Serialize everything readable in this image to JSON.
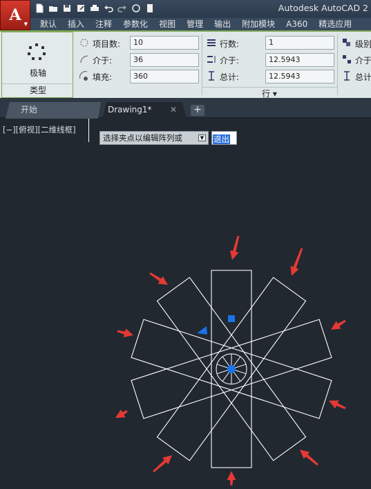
{
  "title_bar": {
    "app_menu_letter": "A",
    "title": "Autodesk AutoCAD 2"
  },
  "ribbon_tabs": [
    "默认",
    "插入",
    "注释",
    "参数化",
    "视图",
    "管理",
    "输出",
    "附加模块",
    "A360",
    "精选应用"
  ],
  "ribbon": {
    "type_panel": {
      "button_label": "极轴",
      "panel_title": "类型"
    },
    "items_panel": {
      "items_label": "项目数:",
      "items_value": "10",
      "between_label": "介于:",
      "between_value": "36",
      "fill_label": "填充:",
      "fill_value": "360"
    },
    "rows_panel": {
      "rows_label": "行数:",
      "rows_value": "1",
      "between_label": "介于:",
      "between_value": "12.5943",
      "total_label": "总计:",
      "total_value": "12.5943",
      "panel_title": "行 ▾"
    },
    "levels_panel": {
      "levels_label": "级别",
      "between_label": "介于",
      "total_label": "总计"
    }
  },
  "file_tabs": {
    "start": "开始",
    "drawing": "Drawing1*",
    "close_glyph": "✕",
    "new_tab_glyph": "+"
  },
  "canvas": {
    "view_label": "[−][俯视][二维线框]",
    "prompt_text": "选择夹点以编辑阵列或",
    "prompt_option": "退出"
  },
  "colors": {
    "canvas_bg": "#212830",
    "ribbon_bg": "#dfe7e7",
    "geometry": "#ffffff",
    "grip": "#1a73e8",
    "annotation_arrow": "#e53935"
  },
  "icons": [
    "new-file-icon",
    "open-file-icon",
    "save-icon",
    "save-as-icon",
    "plot-icon",
    "undo-icon",
    "redo-icon",
    "share-icon",
    "workspace-icon",
    "polar-array-icon",
    "items-count-icon",
    "angle-between-icon",
    "fill-angle-icon",
    "rows-icon",
    "row-spacing-icon",
    "row-total-icon",
    "levels-icon",
    "level-spacing-icon",
    "level-total-icon"
  ]
}
